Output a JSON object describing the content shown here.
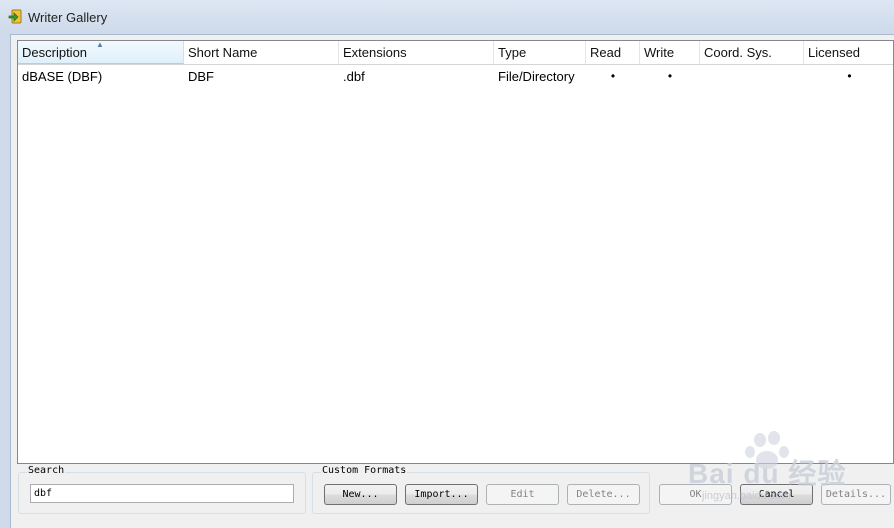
{
  "window": {
    "title": "Writer Gallery"
  },
  "table": {
    "columns": [
      "Description",
      "Short Name",
      "Extensions",
      "Type",
      "Read",
      "Write",
      "Coord. Sys.",
      "Licensed"
    ],
    "rows": [
      {
        "description": "dBASE (DBF)",
        "short_name": "DBF",
        "extensions": ".dbf",
        "type": "File/Directory",
        "read": "•",
        "write": "•",
        "coord_sys": "",
        "licensed": "•"
      }
    ]
  },
  "search": {
    "label": "Search",
    "value": "dbf"
  },
  "custom_formats": {
    "label": "Custom Formats",
    "new": "New...",
    "import": "Import...",
    "edit": "Edit",
    "delete": "Delete..."
  },
  "dialog_buttons": {
    "ok": "OK",
    "cancel": "Cancel",
    "details": "Details..."
  },
  "watermark": {
    "text": "Bai du 经验",
    "sub": "jingyan.baidu.com"
  }
}
